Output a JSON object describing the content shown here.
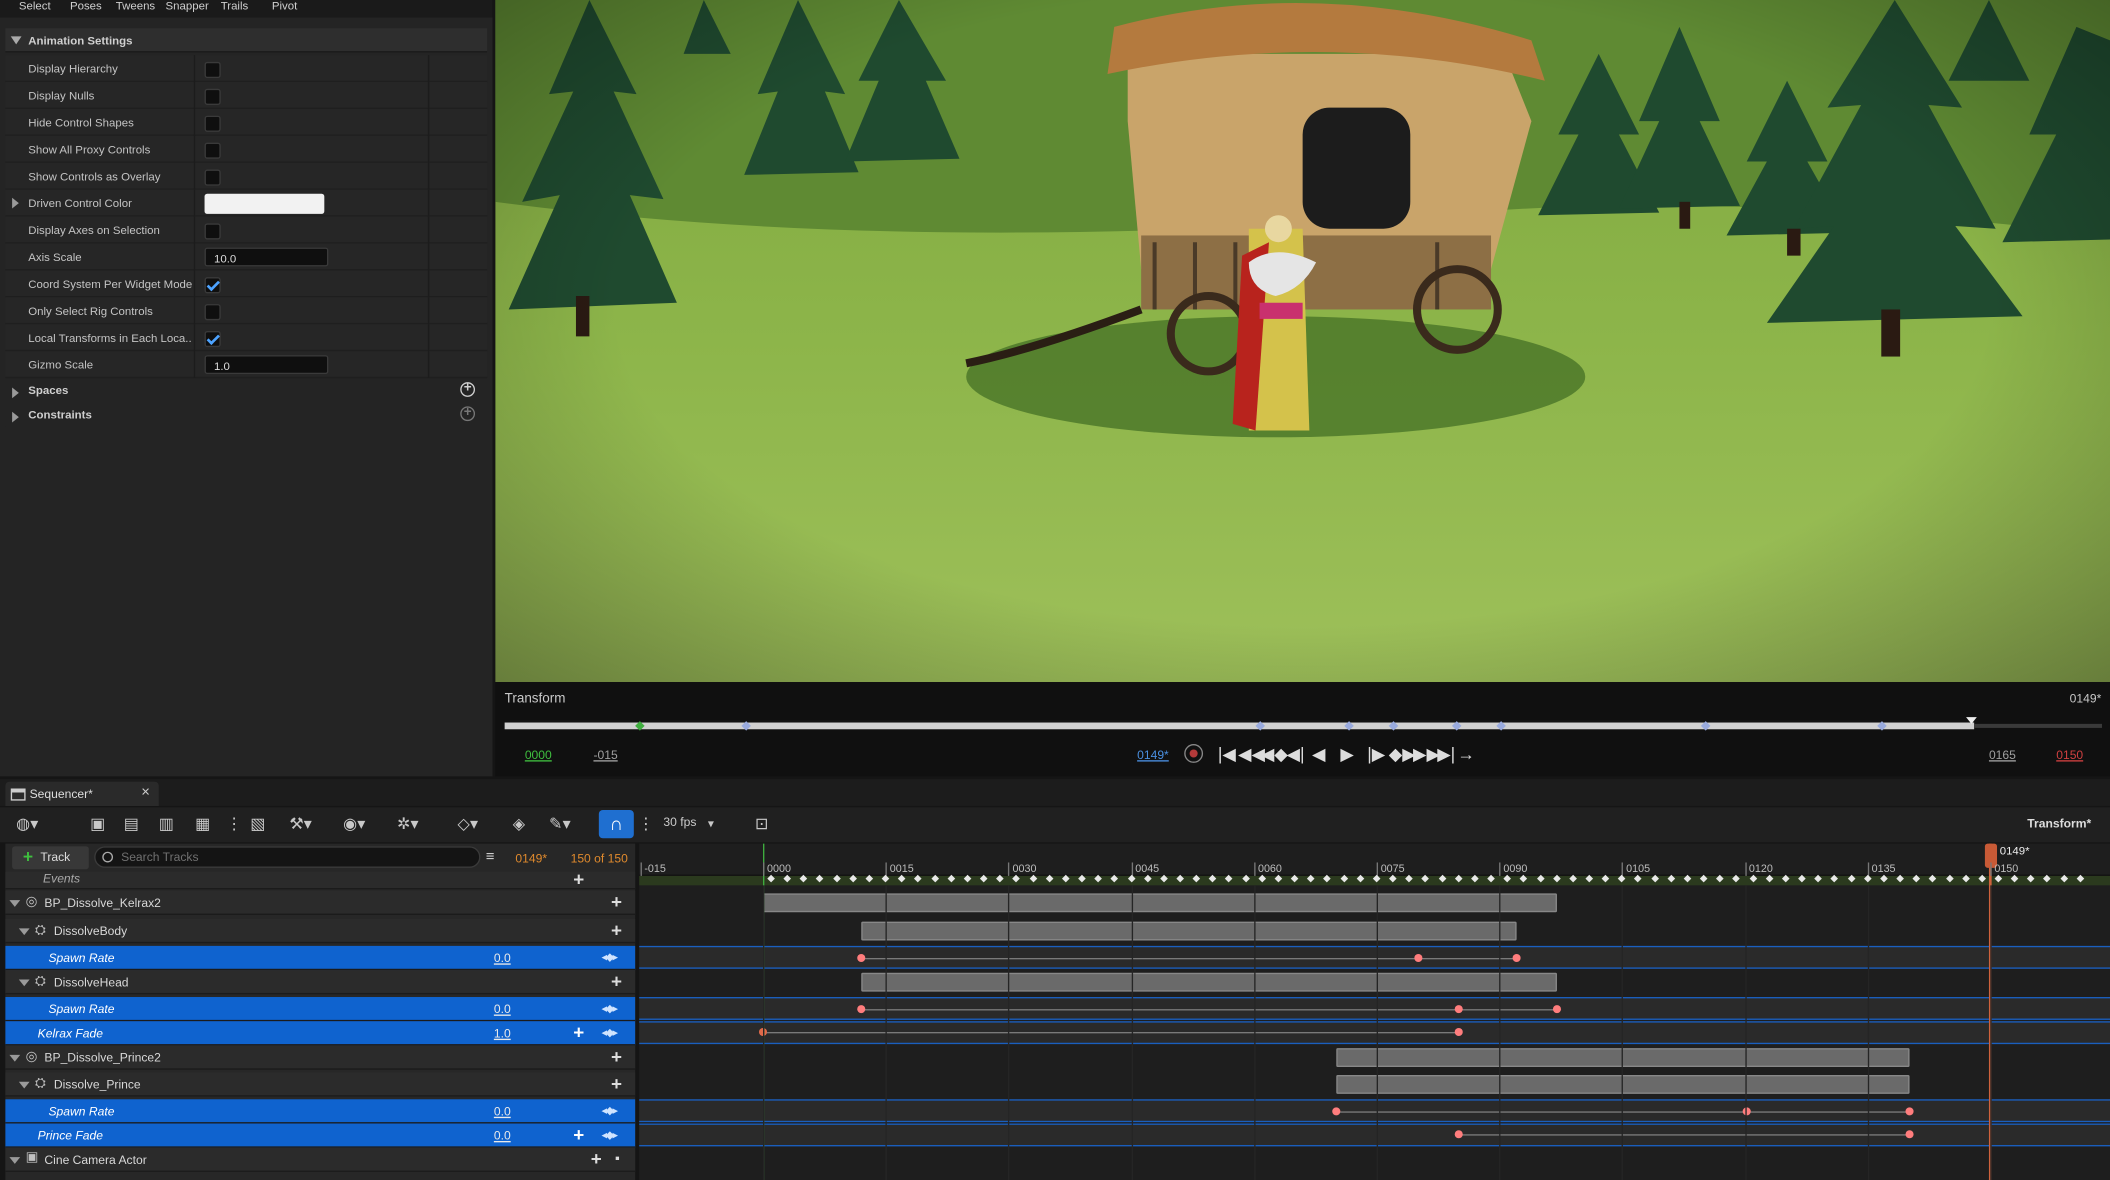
{
  "top_tabs": [
    "Select",
    "Poses",
    "Tweens",
    "Snapper",
    "Trails",
    "Pivot"
  ],
  "section": {
    "title": "Animation Settings"
  },
  "properties": [
    {
      "label": "Display Hierarchy",
      "type": "checkbox",
      "checked": false
    },
    {
      "label": "Display Nulls",
      "type": "checkbox",
      "checked": false
    },
    {
      "label": "Hide Control Shapes",
      "type": "checkbox",
      "checked": false
    },
    {
      "label": "Show All Proxy Controls",
      "type": "checkbox",
      "checked": false
    },
    {
      "label": "Show Controls as Overlay",
      "type": "checkbox",
      "checked": false
    },
    {
      "label": "Driven Control Color",
      "type": "color",
      "color": "#f2f2f2"
    },
    {
      "label": "Display Axes on Selection",
      "type": "checkbox",
      "checked": false
    },
    {
      "label": "Axis Scale",
      "type": "number",
      "value": "10.0"
    },
    {
      "label": "Coord System Per Widget Mode",
      "type": "checkbox",
      "checked": true
    },
    {
      "label": "Only Select Rig Controls",
      "type": "checkbox",
      "checked": false
    },
    {
      "label": "Local Transforms in Each Loca...",
      "type": "checkbox",
      "checked": true
    },
    {
      "label": "Gizmo Scale",
      "type": "number",
      "value": "1.0"
    }
  ],
  "categories": [
    "Spaces",
    "Constraints"
  ],
  "transport": {
    "label": "Transform",
    "frame_right": "0149*",
    "start": "0000",
    "neg": "-015",
    "current": "0149*",
    "end_left": "0165",
    "end_right": "0150",
    "buttons": [
      "|◀",
      "◀◀",
      "◀◆",
      "◀|",
      "◀",
      "▶",
      "|▶",
      "◆▶",
      "▶▶",
      "▶|",
      "→"
    ]
  },
  "sequencer": {
    "tab": "Sequencer*",
    "fps": "30 fps",
    "transform_label": "Transform*",
    "track_button": "Track",
    "search_placeholder": "Search Tracks",
    "current_frame": "0149*",
    "frame_count": "150 of 150",
    "playhead": "0149*",
    "ruler": [
      {
        "label": "-015",
        "frame": -15
      },
      {
        "label": "0000",
        "frame": 0
      },
      {
        "label": "0015",
        "frame": 15
      },
      {
        "label": "0030",
        "frame": 30
      },
      {
        "label": "0045",
        "frame": 45
      },
      {
        "label": "0060",
        "frame": 60
      },
      {
        "label": "0075",
        "frame": 75
      },
      {
        "label": "0090",
        "frame": 90
      },
      {
        "label": "0105",
        "frame": 105
      },
      {
        "label": "0120",
        "frame": 120
      },
      {
        "label": "0135",
        "frame": 135
      },
      {
        "label": "0150",
        "frame": 150
      }
    ],
    "tracks": [
      {
        "name": "Events",
        "value": ""
      },
      {
        "name": "BP_Dissolve_Kelrax2",
        "value": ""
      },
      {
        "name": "DissolveBody",
        "value": ""
      },
      {
        "name": "Spawn Rate",
        "value": "0.0"
      },
      {
        "name": "DissolveHead",
        "value": ""
      },
      {
        "name": "Spawn Rate",
        "value": "0.0"
      },
      {
        "name": "Kelrax Fade",
        "value": "1.0"
      },
      {
        "name": "BP_Dissolve_Prince2",
        "value": ""
      },
      {
        "name": "Dissolve_Prince",
        "value": ""
      },
      {
        "name": "Spawn Rate",
        "value": "0.0"
      },
      {
        "name": "Prince Fade",
        "value": "0.0"
      },
      {
        "name": "Cine Camera Actor",
        "value": ""
      }
    ]
  }
}
